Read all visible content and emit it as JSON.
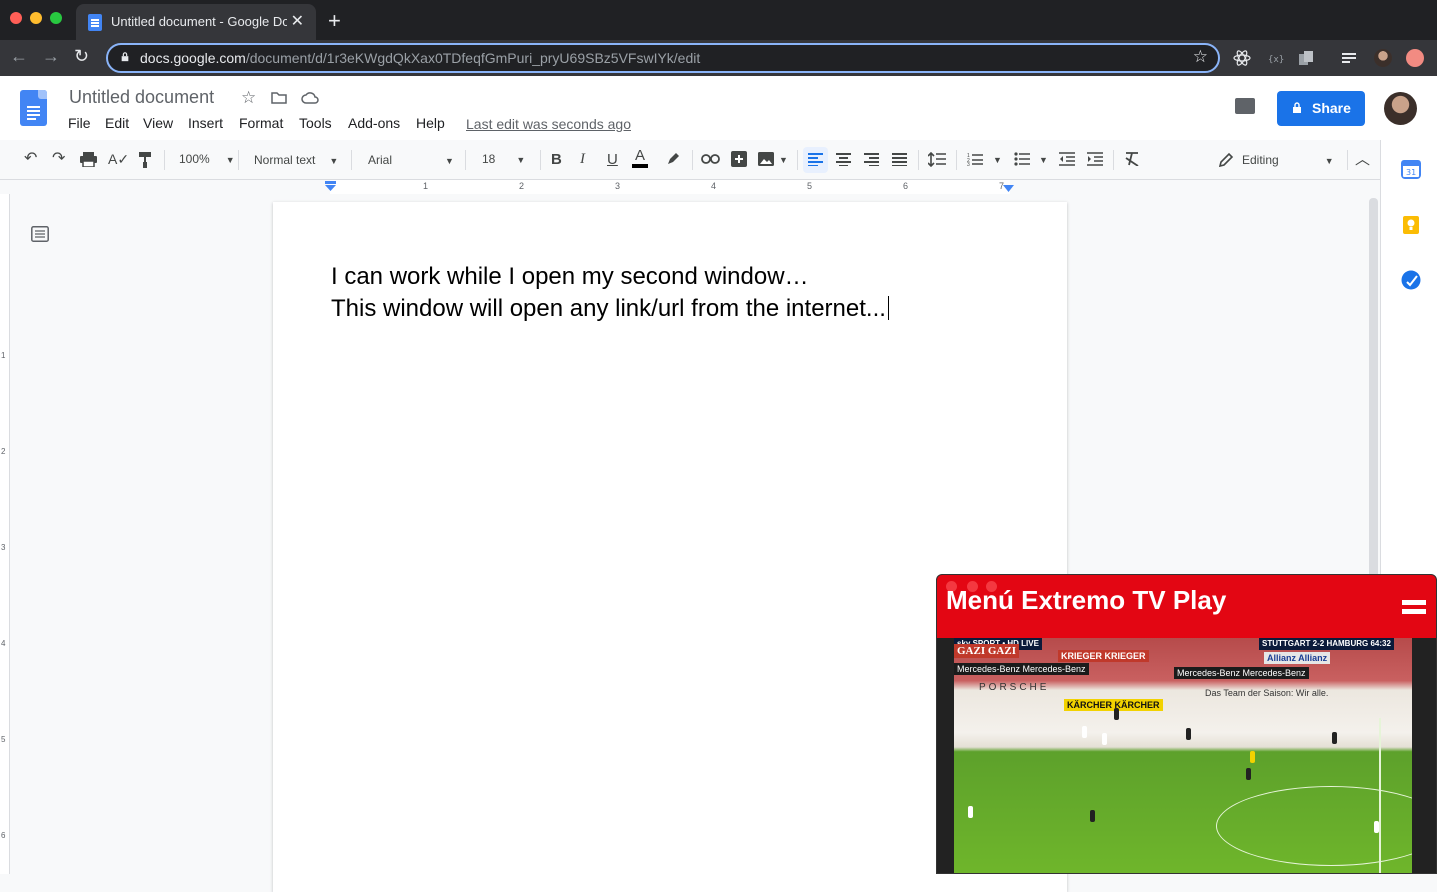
{
  "browser": {
    "tab_title": "Untitled document - Google Docs",
    "new_tab": "+",
    "close_tab": "✕",
    "url_host": "docs.google.com",
    "url_path": "/document/d/1r3eKWgdQkXax0TDfeqfGmPuri_pryU69SBz5VFswIYk/edit"
  },
  "docs": {
    "title": "Untitled document",
    "menu": [
      "File",
      "Edit",
      "View",
      "Insert",
      "Format",
      "Tools",
      "Add-ons",
      "Help"
    ],
    "last_edit": "Last edit was seconds ago",
    "share_label": "Share"
  },
  "toolbar": {
    "zoom": "100%",
    "style": "Normal text",
    "font": "Arial",
    "font_size": "18",
    "mode": "Editing"
  },
  "ruler": [
    "1",
    "2",
    "3",
    "4",
    "5",
    "6",
    "7"
  ],
  "vruler": [
    "1",
    "2",
    "3",
    "4",
    "5",
    "6"
  ],
  "document": {
    "lines": [
      "I can work while I open my second window…",
      "This window will open any link/url from the internet..."
    ]
  },
  "pip": {
    "title": "Menú Extremo TV Play",
    "video_texts": {
      "scoreboard": "STUTTGART 2-2 HAMBURG 64:32",
      "broadcaster": "sky SPORT • HD LIVE",
      "ad_gazi": "GAZI GAZI",
      "ad_krieger": "KRIEGER KRIEGER",
      "ad_allianz": "Allianz  Allianz",
      "ad_mercedes": "Mercedes-Benz   Mercedes-Benz",
      "ad_porsche": "PORSCHE",
      "ad_karcher": "KÄRCHER    KÄRCHER",
      "slogan": "Das Team der Saison: Wir alle."
    }
  },
  "colors": {
    "docs_blue": "#4285f4",
    "share_blue": "#1a73e8",
    "pip_red": "#e30613",
    "chrome_dark": "#202124"
  }
}
